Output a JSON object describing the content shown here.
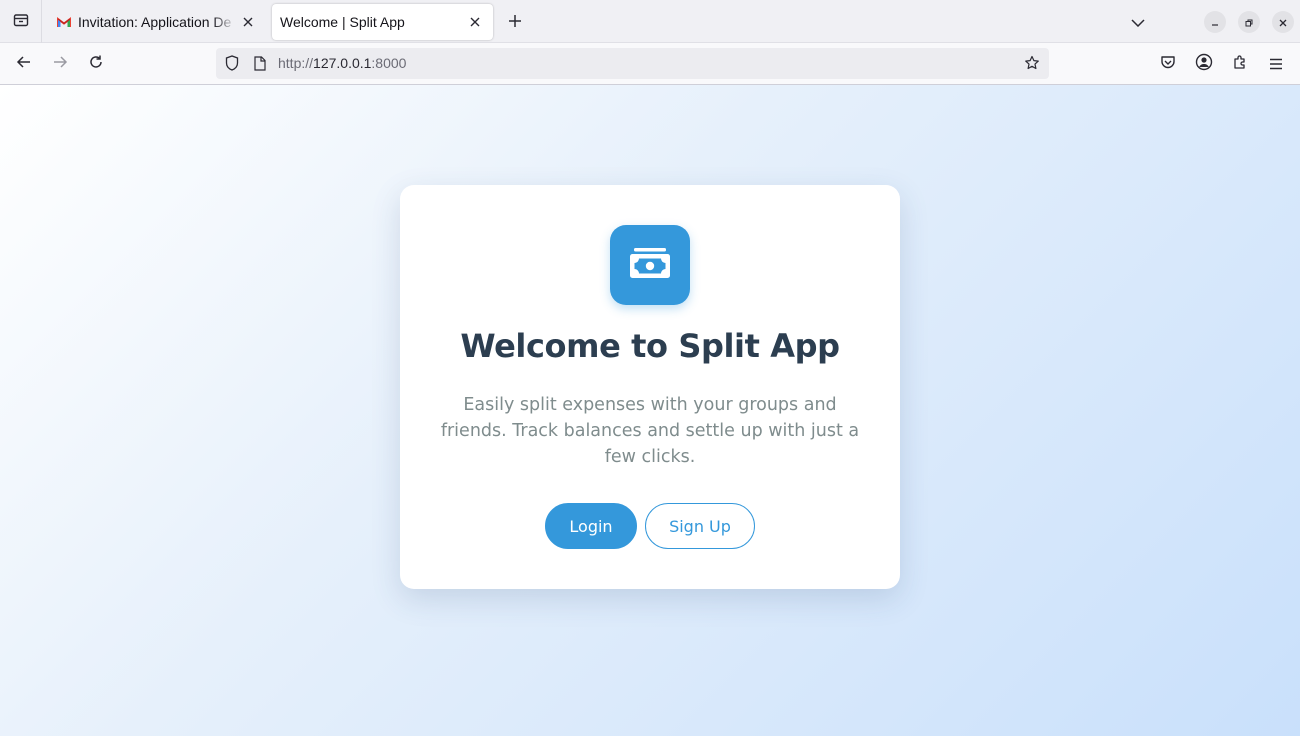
{
  "browser": {
    "tabs": [
      {
        "title": "Invitation: Application De",
        "favicon": "gmail-icon",
        "active": false
      },
      {
        "title": "Welcome | Split App",
        "favicon": "none",
        "active": true
      }
    ],
    "url_scheme": "http://",
    "url_host": "127.0.0.1",
    "url_port": ":8000"
  },
  "page": {
    "logo_icon": "money-bill-icon",
    "heading": "Welcome to Split App",
    "description": "Easily split expenses with your groups and friends. Track balances and settle up with just a few clicks.",
    "login_label": "Login",
    "signup_label": "Sign Up"
  },
  "colors": {
    "accent": "#3498db",
    "heading": "#2c3e50",
    "muted_text": "#7f8c8d"
  }
}
